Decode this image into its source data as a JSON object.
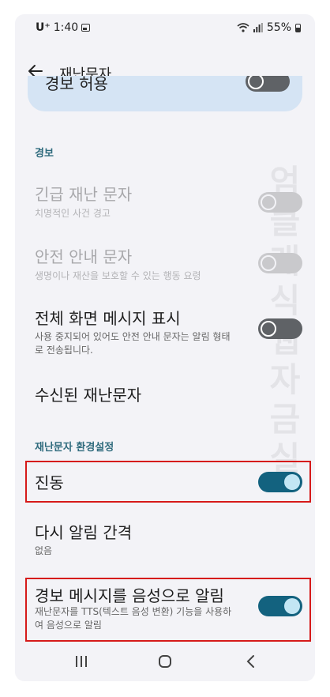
{
  "status": {
    "carrier": "U⁺",
    "time": "1:40",
    "battery": "55%"
  },
  "app_bar": {
    "title": "재난문자"
  },
  "top_card": {
    "label": "경보 허용"
  },
  "sections": {
    "alerts_header": "경보",
    "settings_header": "재난문자 환경설정"
  },
  "items": {
    "emergency": {
      "title": "긴급 재난 문자",
      "sub": "치명적인 사건 경고"
    },
    "safety": {
      "title": "안전 안내 문자",
      "sub": "생명이나 재산을 보호할 수 있는 행동 요령"
    },
    "fullscreen": {
      "title": "전체 화면 메시지 표시",
      "sub": "사용 중지되어 있어도 안전 안내 문자는 알림 형태로 전송됩니다."
    },
    "received": {
      "title": "수신된 재난문자"
    },
    "vibration": {
      "title": "진동"
    },
    "reminder": {
      "title": "다시 알림 간격",
      "sub": "없음"
    },
    "tts": {
      "title": "경보 메시지를 음성으로 알림",
      "sub": "재난문자를 TTS(텍스트 음성 변환) 기능을 사용하여 음성으로 알림"
    }
  },
  "toggles": {
    "allow_alerts": false,
    "emergency": false,
    "safety": false,
    "fullscreen": false,
    "vibration": true,
    "tts": true
  },
  "watermark": "엄클래식 웹자금실",
  "colors": {
    "accent": "#13627f",
    "highlight": "#d61a1a",
    "card": "#d5e4f4"
  }
}
